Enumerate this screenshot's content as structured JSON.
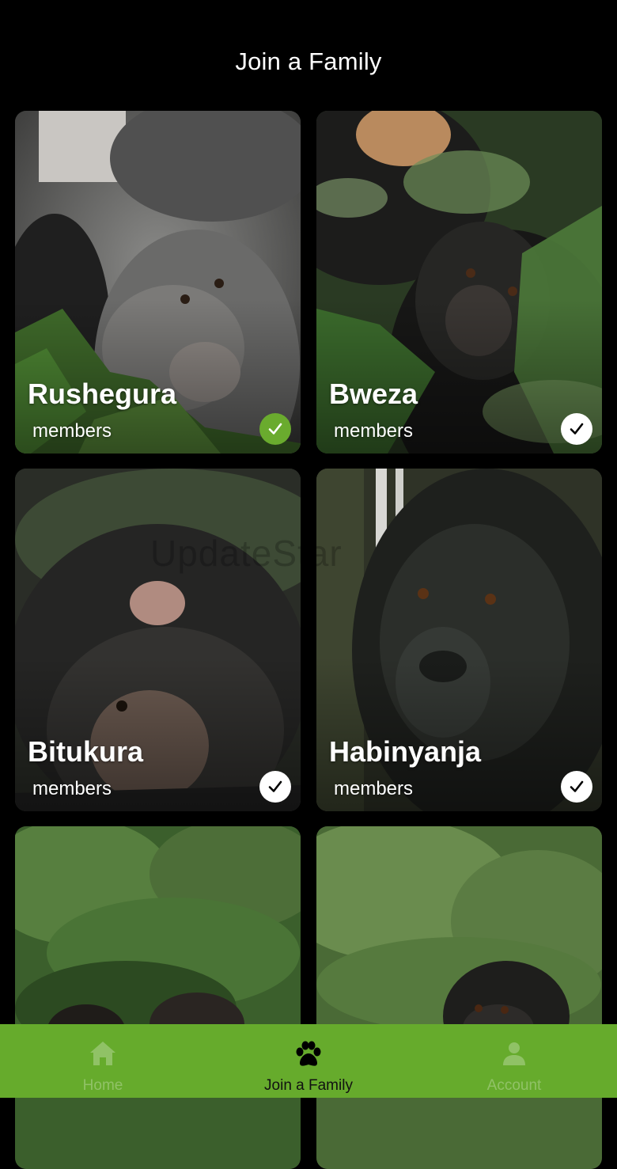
{
  "header": {
    "title": "Join a Family"
  },
  "families": [
    {
      "name": "Rushegura",
      "members_label": "members",
      "selected": true
    },
    {
      "name": "Bweza",
      "members_label": "members",
      "selected": false
    },
    {
      "name": "Bitukura",
      "members_label": "members",
      "selected": false
    },
    {
      "name": "Habinyanja",
      "members_label": "members",
      "selected": false
    },
    {
      "name": "",
      "members_label": "",
      "selected": false
    },
    {
      "name": "",
      "members_label": "",
      "selected": false
    }
  ],
  "watermark": "UpdateStar",
  "tabbar": {
    "tabs": [
      {
        "label": "Home",
        "icon": "home-icon",
        "active": false
      },
      {
        "label": "Join a Family",
        "icon": "paw-icon",
        "active": true
      },
      {
        "label": "Account",
        "icon": "person-icon",
        "active": false
      }
    ]
  },
  "colors": {
    "accent": "#66ab2c",
    "check_selected": "#6aab2e",
    "background": "#000000"
  }
}
